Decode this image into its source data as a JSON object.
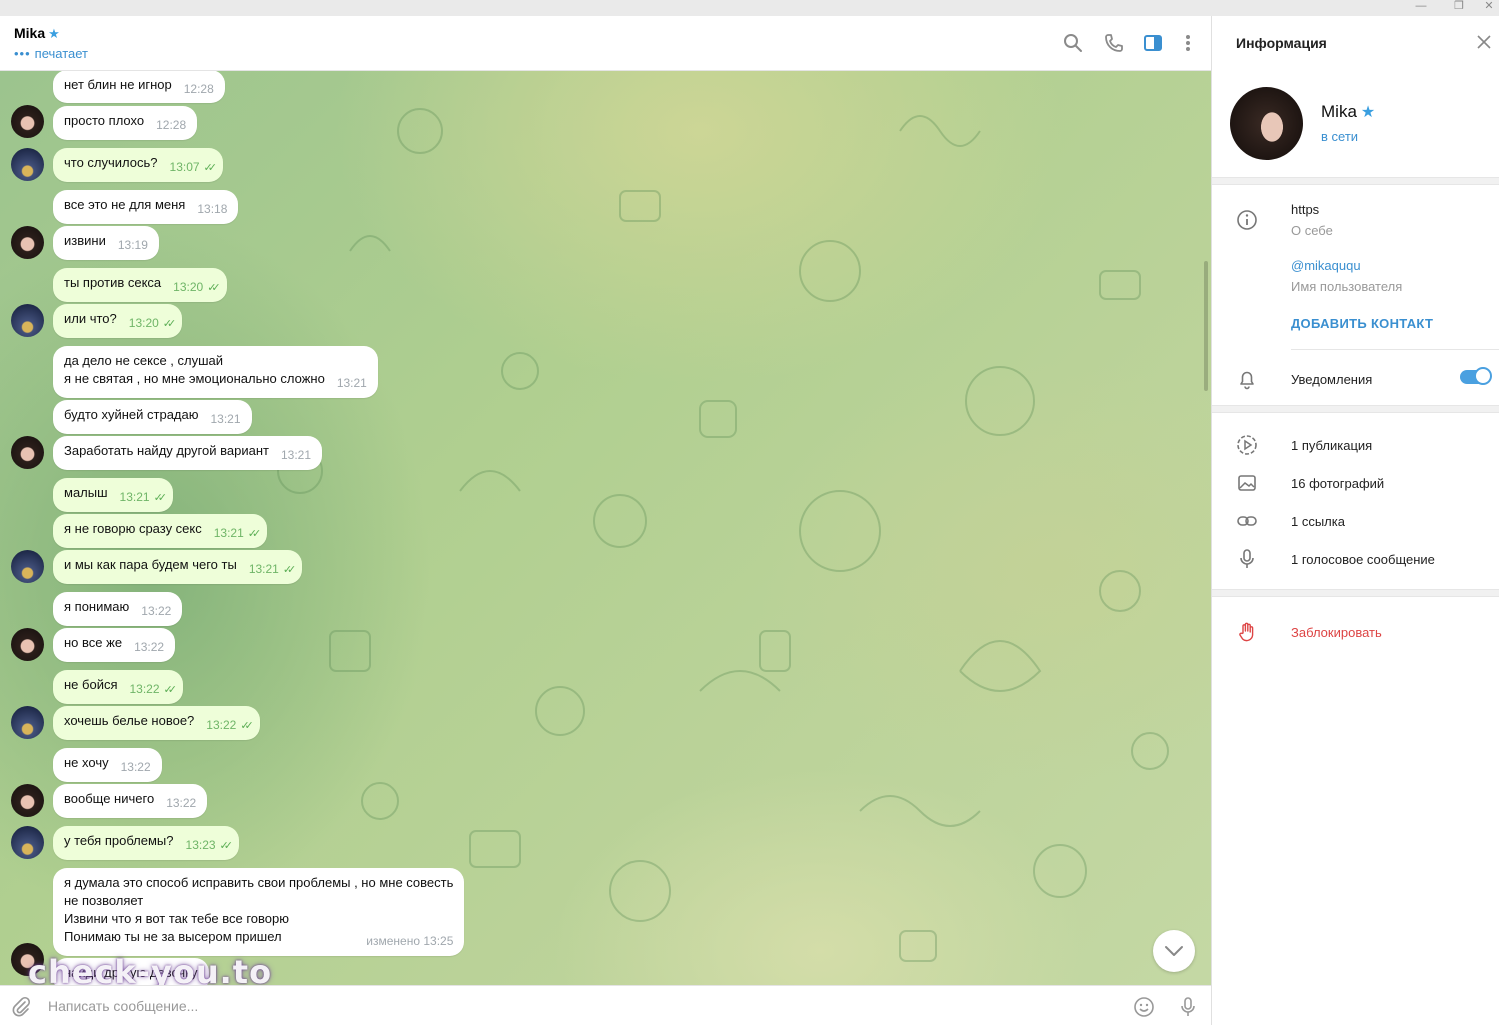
{
  "chat": {
    "name": "Mika",
    "status": "печатает",
    "messages": [
      {
        "text": "нет блин не игнор",
        "time": "12:28",
        "out": false
      },
      {
        "text": "просто плохо",
        "time": "12:28",
        "out": false
      },
      {
        "text": "что случилось?",
        "time": "13:07",
        "out": true
      },
      {
        "text": "все это не для меня",
        "time": "13:18",
        "out": false
      },
      {
        "text": "извини",
        "time": "13:19",
        "out": false
      },
      {
        "text": "ты против секса",
        "time": "13:20",
        "out": true
      },
      {
        "text": "или что?",
        "time": "13:20",
        "out": true
      },
      {
        "lines": [
          "да дело не сексе , слушай",
          "я не святая , но мне эмоционально сложно"
        ],
        "time": "13:21",
        "out": false
      },
      {
        "text": "будто хуйней страдаю",
        "time": "13:21",
        "out": false
      },
      {
        "text": "Заработать найду другой вариант",
        "time": "13:21",
        "out": false
      },
      {
        "text": "малыш",
        "time": "13:21",
        "out": true
      },
      {
        "text": "я не говорю сразу секс",
        "time": "13:21",
        "out": true
      },
      {
        "text": "и мы как пара будем чего ты",
        "time": "13:21",
        "out": true
      },
      {
        "text": "я понимаю",
        "time": "13:22",
        "out": false
      },
      {
        "text": "но все же",
        "time": "13:22",
        "out": false
      },
      {
        "text": "не бойся",
        "time": "13:22",
        "out": true
      },
      {
        "text": "хочешь белье новое?",
        "time": "13:22",
        "out": true
      },
      {
        "text": "не хочу",
        "time": "13:22",
        "out": false
      },
      {
        "text": "вообще ничего",
        "time": "13:22",
        "out": false
      },
      {
        "text": "у тебя проблемы?",
        "time": "13:23",
        "out": true
      },
      {
        "lines": [
          "я думала это способ исправить свои проблемы , но мне совесть",
          "не позволяет",
          "Извини что я вот так тебе все говорю",
          "Понимаю ты не за высером пришел"
        ],
        "time": "изменено 13:25",
        "out": false
      },
      {
        "text": "найди другую девочку",
        "time": "",
        "out": false
      }
    ]
  },
  "composer": {
    "placeholder": "Написать сообщение..."
  },
  "watermark": "check-you.to",
  "info": {
    "title": "Информация",
    "name": "Mika",
    "status": "в сети",
    "bio": "https",
    "bio_label": "О себе",
    "username": "@mikaququ",
    "username_label": "Имя пользователя",
    "add_contact": "ДОБАВИТЬ КОНТАКТ",
    "notifications": "Уведомления",
    "notifications_on": true,
    "media": [
      {
        "label": "1 публикация",
        "icon": "story-icon"
      },
      {
        "label": "16 фотографий",
        "icon": "photo-icon"
      },
      {
        "label": "1 ссылка",
        "icon": "link-icon"
      },
      {
        "label": "1 голосовое сообщение",
        "icon": "microphone-icon"
      }
    ],
    "block": "Заблокировать"
  },
  "colors": {
    "accent": "#3a8fd0",
    "outgoing_bubble": "#eefed9",
    "incoming_bubble": "#ffffff",
    "check": "#5cae55",
    "danger": "#dd4444"
  }
}
